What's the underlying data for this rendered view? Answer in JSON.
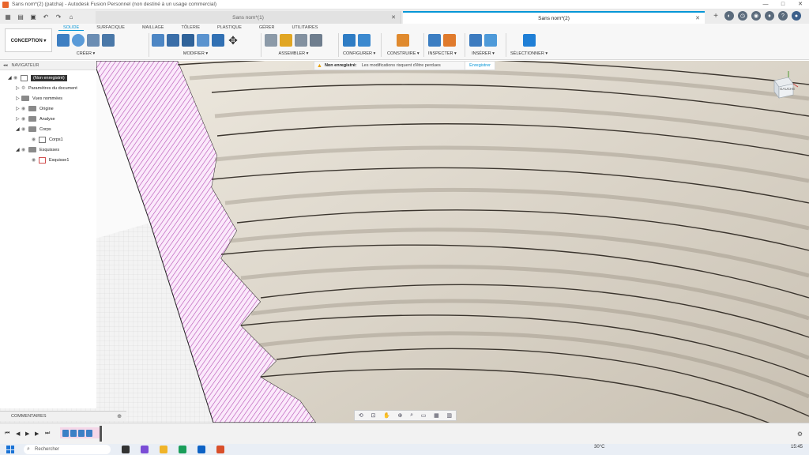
{
  "window": {
    "title": "Sans nom*(2) (patcha) - Autodesk Fusion Personnel (non destiné à un usage commercial)",
    "controls": [
      "—",
      "□",
      "✕"
    ]
  },
  "tabs": {
    "inactive_label": "Sans nom*(1)",
    "active_label": "Sans nom*(2)"
  },
  "ribbon": {
    "workspace": "CONCEPTION ▾",
    "tabs": [
      "SOLIDE",
      "SURFACIQUE",
      "MAILLAGE",
      "TÔLERIE",
      "PLASTIQUE",
      "GÉRER",
      "UTILITAIRES"
    ],
    "groups": {
      "creer": "CRÉER ▾",
      "modifier": "MODIFIER ▾",
      "assembler": "ASSEMBLER ▾",
      "configurer": "CONFIGURER ▾",
      "construire": "CONSTRUIRE ▾",
      "inspecter": "INSPECTER ▾",
      "inserer": "INSÉRER ▾",
      "selectionner": "SÉLECTIONNER ▾"
    }
  },
  "navigator": {
    "header": "NAVIGATEUR",
    "root": "(Non enregistré)",
    "items": [
      {
        "label": "Paramètres du document"
      },
      {
        "label": "Vues nommées"
      },
      {
        "label": "Origine"
      },
      {
        "label": "Analyse"
      },
      {
        "label": "Corps"
      },
      {
        "label": "Corps1"
      },
      {
        "label": "Esquisses"
      },
      {
        "label": "Esquisse1"
      }
    ]
  },
  "banner": {
    "status": "Non enregistré:",
    "message": "Les modifications risquent d'être perdues",
    "action": "Enregistrer"
  },
  "viewcube": {
    "label": "GAUCHE"
  },
  "comments": {
    "label": "COMMENTAIRES"
  },
  "taskbar": {
    "search": "Rechercher",
    "weather": "30°C",
    "time": "15:45"
  },
  "colors": {
    "accent": "#0696d7",
    "hatch": "#c05cc0",
    "model": "#d9d3c8"
  }
}
